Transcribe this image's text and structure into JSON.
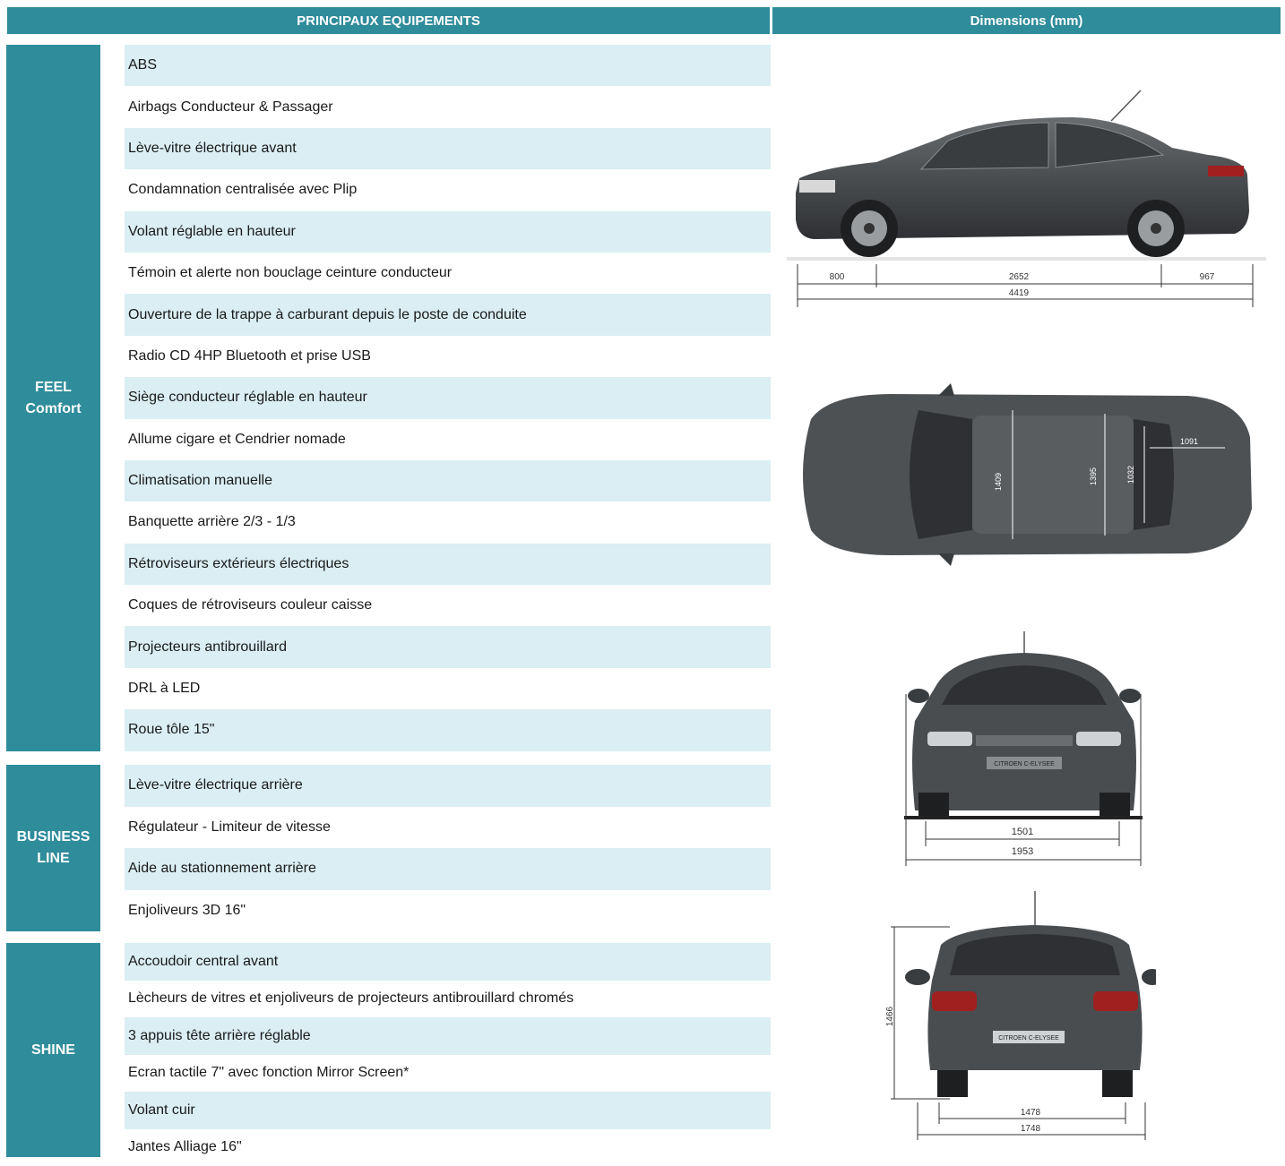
{
  "header": {
    "left": "PRINCIPAUX EQUIPEMENTS",
    "right": "Dimensions (mm)"
  },
  "groups": [
    {
      "name_lines": [
        "FEEL",
        "Comfort"
      ],
      "items": [
        "ABS",
        "Airbags Conducteur & Passager",
        "Lève-vitre électrique avant",
        "Condamnation centralisée avec Plip",
        "Volant réglable en hauteur",
        "Témoin et alerte non bouclage ceinture conducteur",
        "Ouverture de la trappe à carburant depuis le poste de conduite",
        "Radio CD 4HP Bluetooth et prise USB",
        "Siège conducteur réglable en hauteur",
        "Allume cigare et Cendrier nomade",
        "Climatisation manuelle",
        "Banquette arrière 2/3 - 1/3",
        "Rétroviseurs extérieurs électriques",
        "Coques de rétroviseurs couleur caisse",
        "Projecteurs antibrouillard",
        "DRL à LED",
        "Roue tôle 15\""
      ]
    },
    {
      "name_lines": [
        "BUSINESS",
        "LINE"
      ],
      "items": [
        "Lève-vitre électrique arrière",
        "Régulateur - Limiteur de vitesse",
        "Aide au stationnement arrière",
        "Enjoliveurs 3D 16\""
      ]
    },
    {
      "name_lines": [
        "SHINE"
      ],
      "items": [
        "Accoudoir central avant",
        "Lècheurs de vitres et enjoliveurs de projecteurs antibrouillard chromés",
        "3 appuis tête arrière réglable",
        "Ecran tactile 7\" avec fonction Mirror Screen*",
        "Volant cuir",
        "Jantes Alliage 16\""
      ]
    }
  ],
  "dimensions": {
    "side": {
      "front_overhang": "800",
      "wheelbase": "2652",
      "rear_overhang": "967",
      "length": "4419"
    },
    "top": {
      "front_width": "1409",
      "rear_width": "1395",
      "boot_width": "1032",
      "boot_length": "1091"
    },
    "front": {
      "track": "1501",
      "width": "1953"
    },
    "rear": {
      "height": "1466",
      "track": "1478",
      "width": "1748"
    }
  },
  "rear_badge": "CITROEN C-ELYSEE",
  "front_badge": "CITROEN C-ELYSEE",
  "colors": {
    "teal": "#2f8c9b",
    "row_shade": "#daeef3",
    "car_body": "#4a4d50"
  }
}
